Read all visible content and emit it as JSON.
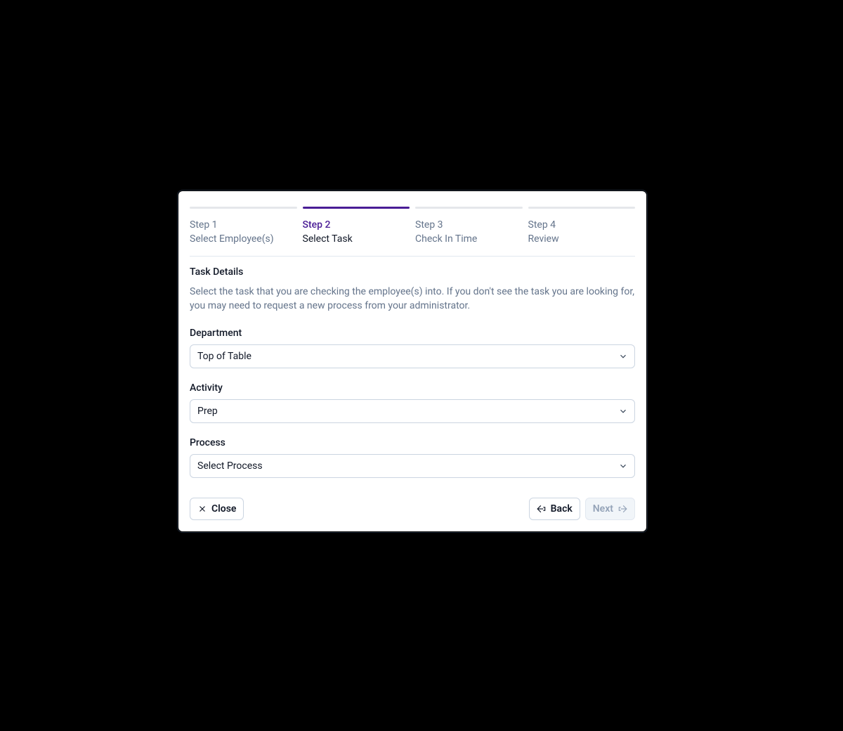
{
  "stepper": {
    "active_index": 1,
    "steps": [
      {
        "index_label": "Step 1",
        "label": "Select Employee(s)"
      },
      {
        "index_label": "Step 2",
        "label": "Select Task"
      },
      {
        "index_label": "Step 3",
        "label": "Check In Time"
      },
      {
        "index_label": "Step 4",
        "label": "Review"
      }
    ]
  },
  "section": {
    "title": "Task Details",
    "description": "Select the task that you are checking the employee(s) into. If you don't see the task you are looking for, you may need to request a new process from your administrator."
  },
  "fields": {
    "department": {
      "label": "Department",
      "value": "Top of Table"
    },
    "activity": {
      "label": "Activity",
      "value": "Prep"
    },
    "process": {
      "label": "Process",
      "value": "Select Process"
    }
  },
  "footer": {
    "close_label": "Close",
    "back_label": "Back",
    "next_label": "Next",
    "next_disabled": true
  }
}
